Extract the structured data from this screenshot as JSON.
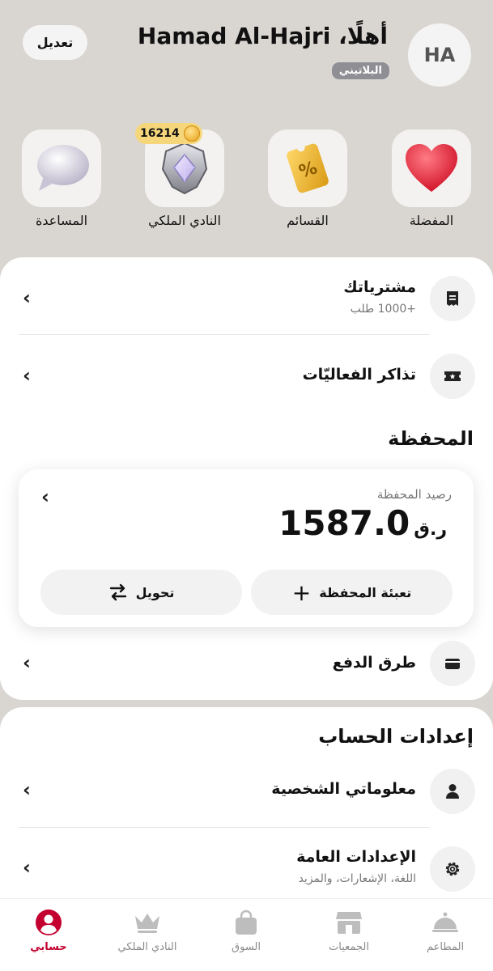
{
  "header": {
    "avatar_initials": "HA",
    "greeting": "أهلًا، Hamad Al-Hajri",
    "tier": "البلاتيني",
    "edit_label": "تعديل"
  },
  "quick_tiles": [
    {
      "label": "المفضلة",
      "icon": "heart-icon"
    },
    {
      "label": "القسائم",
      "icon": "voucher-icon"
    },
    {
      "label": "النادي الملكي",
      "icon": "royal-club-emblem-icon",
      "badge": "16214"
    },
    {
      "label": "المساعدة",
      "icon": "chat-bubble-icon"
    }
  ],
  "rows": {
    "purchases": {
      "title": "مشترياتك",
      "subtitle": "+1000 طلب",
      "icon": "receipt-icon"
    },
    "tickets": {
      "title": "تذاكر الفعاليّات",
      "icon": "ticket-icon"
    },
    "payment_methods": {
      "title": "طرق الدفع",
      "icon": "wallet-icon"
    }
  },
  "wallet": {
    "section_title": "المحفظة",
    "balance_label": "رصيد المحفظة",
    "balance": "1587.0",
    "currency": "ر.ق",
    "topup_label": "تعبئة المحفظة",
    "transfer_label": "تحويل"
  },
  "account_settings": {
    "section_title": "إعدادات الحساب",
    "personal": {
      "title": "معلوماتي الشخصية",
      "icon": "user-icon"
    },
    "general": {
      "title": "الإعدادات العامة",
      "subtitle": "اللغة، الإشعارات، والمزيد",
      "icon": "gear-icon"
    }
  },
  "nav": [
    {
      "label": "المطاعم",
      "icon": "cloche-icon"
    },
    {
      "label": "الجمعيات",
      "icon": "store-icon"
    },
    {
      "label": "السوق",
      "icon": "shopping-bag-icon"
    },
    {
      "label": "النادي الملكي",
      "icon": "crown-icon"
    },
    {
      "label": "حسابي",
      "icon": "account-icon",
      "active": true
    }
  ],
  "colors": {
    "accent": "#c3002f",
    "background": "#d9d6d2",
    "tier_badge": "#8e8e94",
    "coin_badge": "#f5d67a"
  }
}
